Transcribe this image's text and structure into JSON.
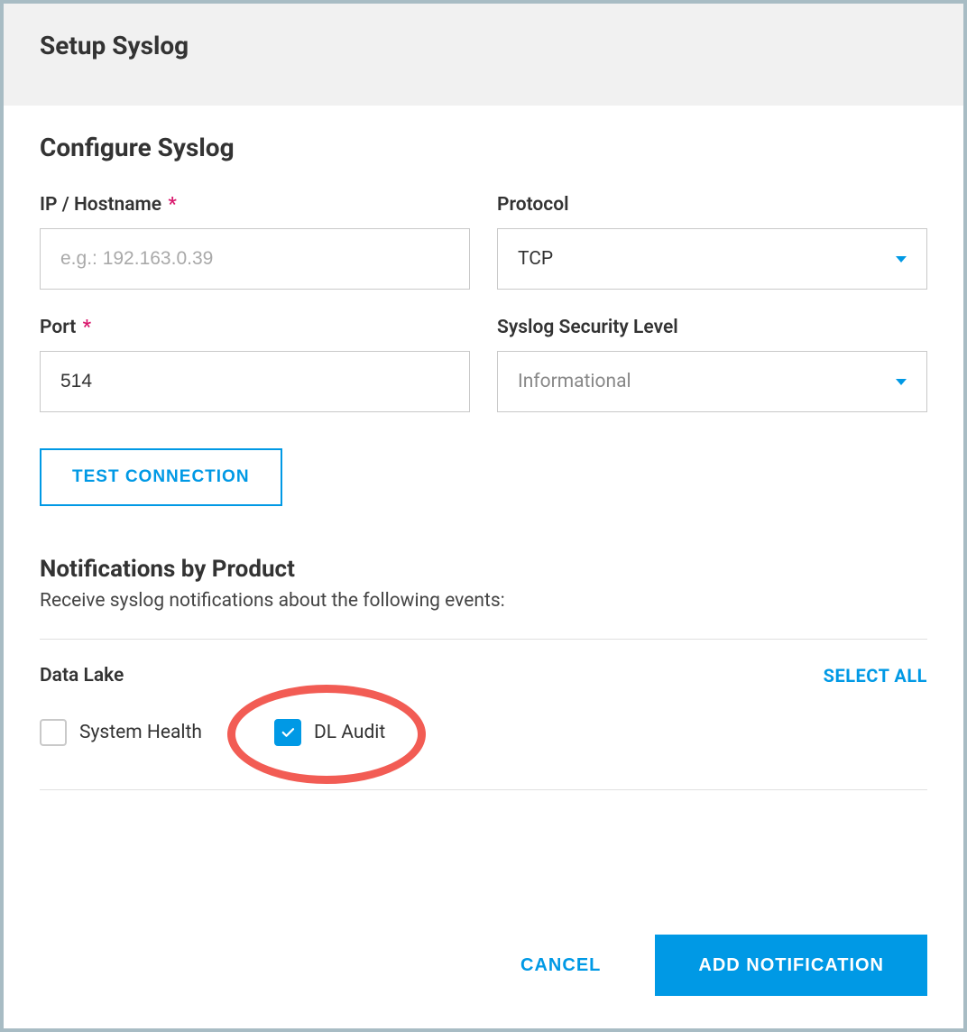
{
  "header": {
    "title": "Setup Syslog"
  },
  "section": {
    "heading": "Configure Syslog",
    "ip_label": "IP / Hostname",
    "ip_placeholder": "e.g.: 192.163.0.39",
    "ip_value": "",
    "protocol_label": "Protocol",
    "protocol_value": "TCP",
    "port_label": "Port",
    "port_value": "514",
    "security_label": "Syslog Security Level",
    "security_value": "Informational",
    "test_btn": "TEST CONNECTION"
  },
  "notifications": {
    "heading": "Notifications by Product",
    "description": "Receive syslog notifications about the following events:",
    "product": "Data Lake",
    "select_all": "SELECT ALL",
    "items": [
      {
        "label": "System Health",
        "checked": false
      },
      {
        "label": "DL Audit",
        "checked": true
      }
    ]
  },
  "footer": {
    "cancel": "CANCEL",
    "submit": "ADD NOTIFICATION"
  }
}
